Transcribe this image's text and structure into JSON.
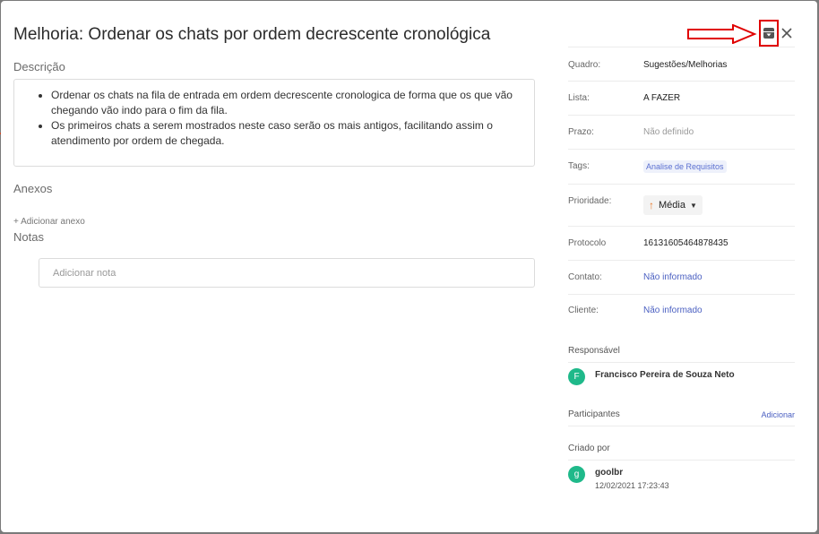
{
  "title": "Melhoria: Ordenar os chats por ordem decrescente cronológica",
  "descricao": {
    "label": "Descrição",
    "items": [
      "Ordenar os chats na fila de entrada em ordem decrescente cronologica de forma que os que vão chegando vão indo para o fim da fila.",
      "Os primeiros chats a serem mostrados neste caso serão os mais antigos, facilitando assim o atendimento por ordem de chegada."
    ]
  },
  "anexos": {
    "label": "Anexos",
    "add_label": "+ Adicionar anexo"
  },
  "notas": {
    "label": "Notas",
    "placeholder": "Adicionar nota"
  },
  "details": {
    "quadro": {
      "label": "Quadro:",
      "value": "Sugestões/Melhorias"
    },
    "lista": {
      "label": "Lista:",
      "value": "A FAZER"
    },
    "prazo": {
      "label": "Prazo:",
      "value": "Não definido"
    },
    "tags": {
      "label": "Tags:",
      "value": "Analise de Requisitos"
    },
    "prioridade": {
      "label": "Prioridade:",
      "value": "Média"
    },
    "protocolo": {
      "label": "Protocolo",
      "value": "16131605464878435"
    },
    "contato": {
      "label": "Contato:",
      "value": "Não informado"
    },
    "cliente": {
      "label": "Cliente:",
      "value": "Não informado"
    }
  },
  "responsavel": {
    "label": "Responsável",
    "initial": "F",
    "name": "Francisco Pereira de Souza Neto"
  },
  "participantes": {
    "label": "Participantes",
    "add_label": "Adicionar"
  },
  "criado_por": {
    "label": "Criado por",
    "initial": "g",
    "name": "goolbr",
    "date": "12/02/2021 17:23:43"
  },
  "icons": {
    "archive": "archive-icon",
    "close": "close-icon",
    "annotation": "red-arrow-annotation"
  },
  "colors": {
    "accent_link": "#4a5fc1",
    "avatar": "#1fb98a",
    "priority_arrow": "#e8792b",
    "annotation_red": "#e00000"
  }
}
